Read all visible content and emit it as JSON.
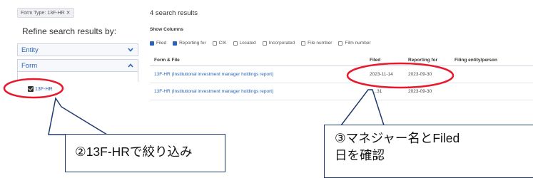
{
  "sidebar": {
    "form_type_tag": "Form Type: 13F-HR ✕",
    "refine_title": "Refine search results by:",
    "facets": [
      {
        "label": "Entity",
        "state": "collapsed"
      },
      {
        "label": "Form",
        "state": "expanded"
      }
    ],
    "selected_value": "13F-HR"
  },
  "results": {
    "count_text": "4 search results",
    "show_columns_label": "Show Columns",
    "column_toggles": [
      {
        "label": "Filed",
        "checked": true
      },
      {
        "label": "Reporting for",
        "checked": true
      },
      {
        "label": "CIK",
        "checked": false
      },
      {
        "label": "Located",
        "checked": false
      },
      {
        "label": "Incorporated",
        "checked": false
      },
      {
        "label": "File number",
        "checked": false
      },
      {
        "label": "Film number",
        "checked": false
      }
    ],
    "headers": {
      "form_file": "Form & File",
      "filed": "Filed",
      "reporting_for": "Reporting for",
      "filing_entity": "Filing entity/person"
    },
    "rows": [
      {
        "form_file": "13F-HR (Institutional investment manager holdings report)",
        "filed": "2023-11-14",
        "reporting_for": "2023-09-30"
      },
      {
        "form_file": "13F-HR (Institutional investment manager holdings report)",
        "filed": "2…31",
        "reporting_for": "2023-09-30"
      }
    ]
  },
  "annotations": {
    "left_callout": "②13F-HRで絞り込み",
    "right_callout_line1": "③マネジャー名とFiled",
    "right_callout_line2": "日を確認",
    "mark_color": "#e8192c",
    "callout_border_color": "#1f3a6e",
    "accent_color": "#2a63b5"
  }
}
